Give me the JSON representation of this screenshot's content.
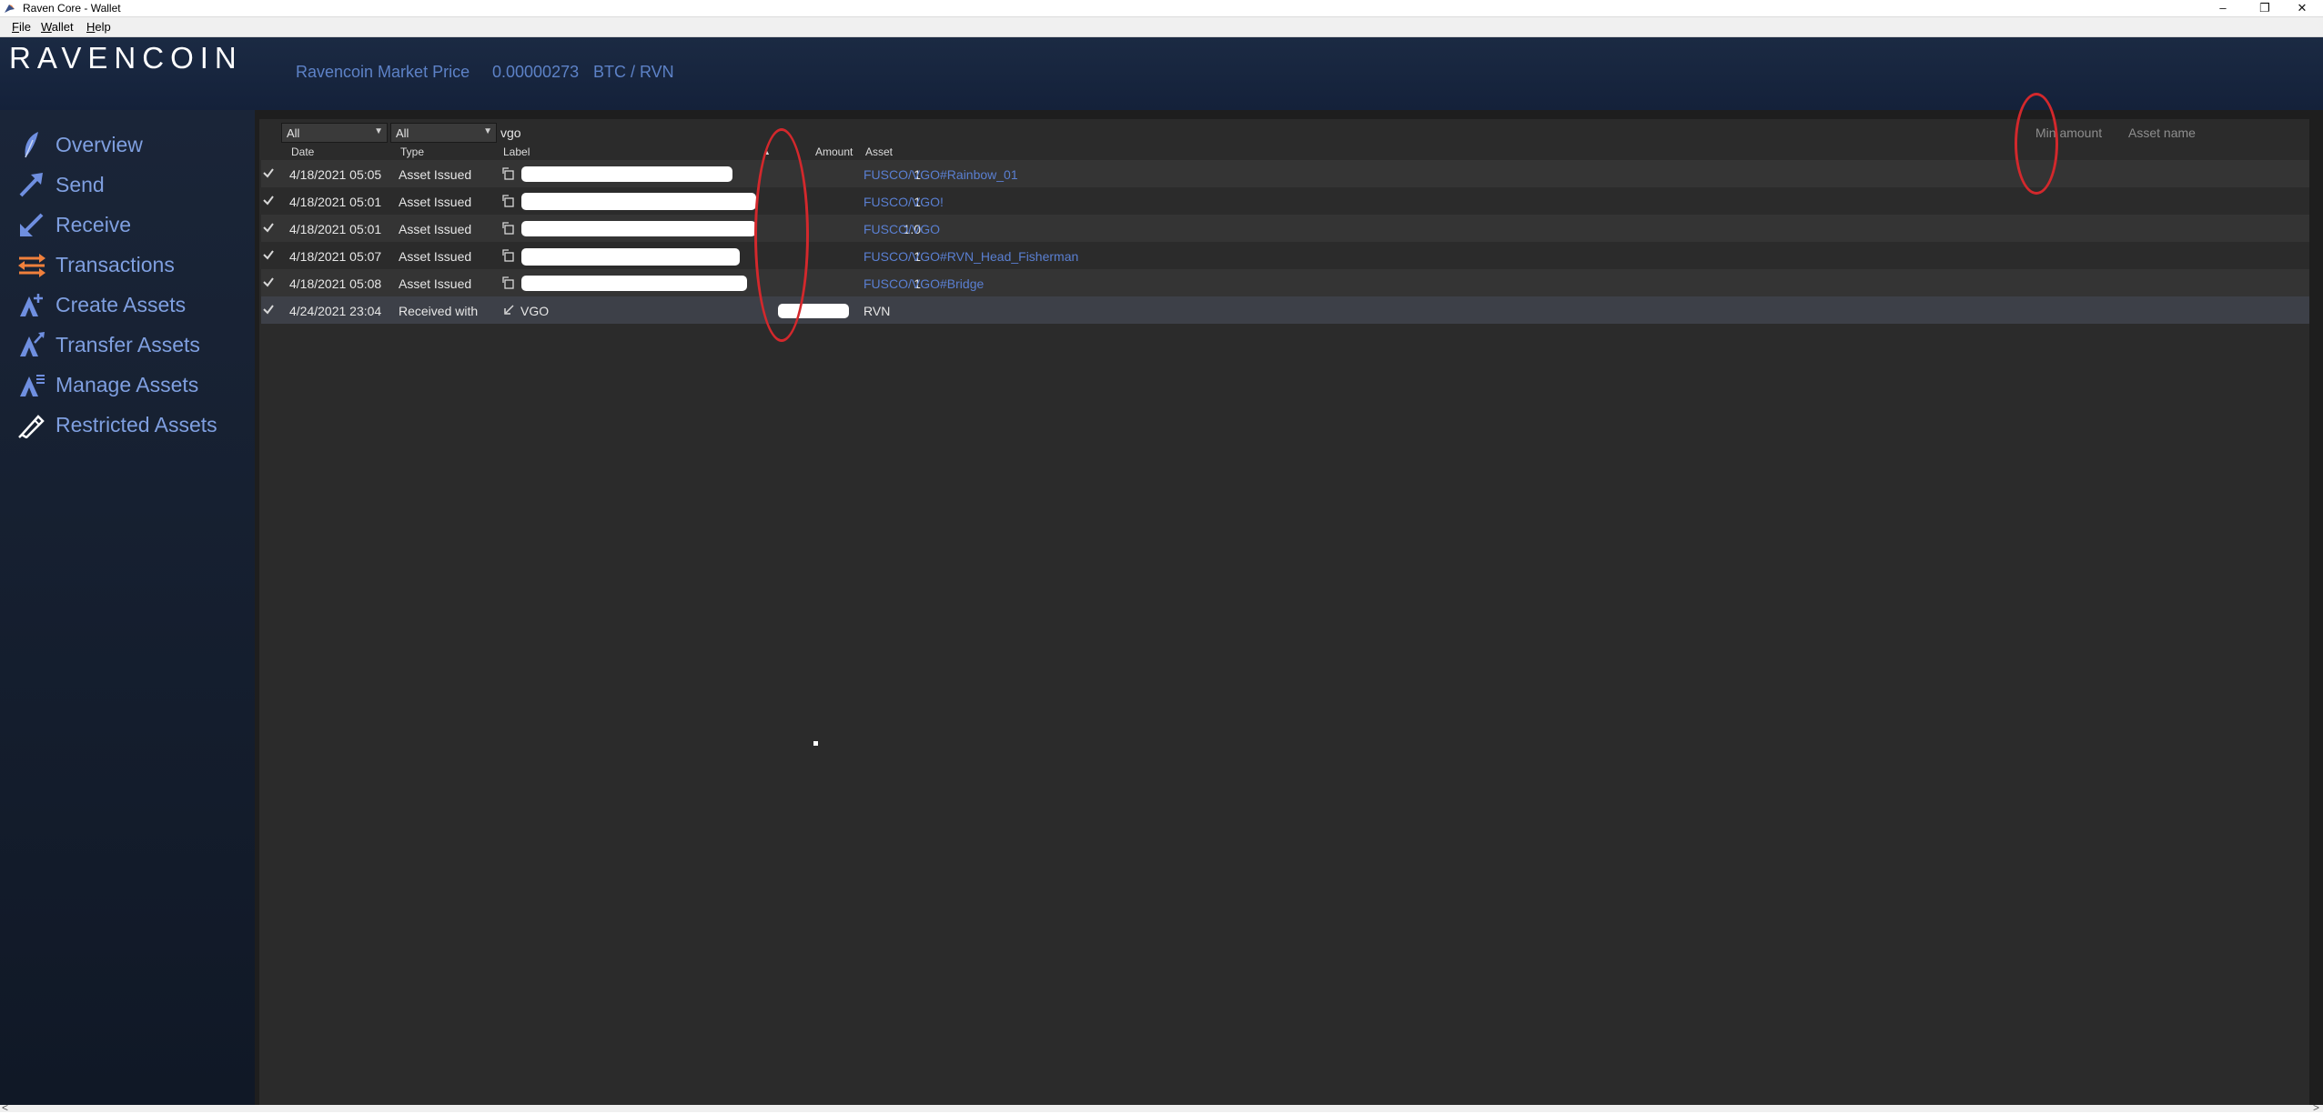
{
  "window": {
    "title": "Raven Core - Wallet",
    "minimize_glyph": "–",
    "restore_glyph": "❐",
    "close_glyph": "✕"
  },
  "menu": {
    "file": {
      "mnemonic": "F",
      "rest": "ile"
    },
    "wallet": {
      "mnemonic": "W",
      "rest": "allet"
    },
    "help": {
      "mnemonic": "H",
      "rest": "elp"
    }
  },
  "header": {
    "logo": "RAVENCOIN",
    "market_label": "Ravencoin Market Price",
    "market_value": "0.00000273",
    "market_unit": "BTC / RVN"
  },
  "sidebar": {
    "items": [
      {
        "label": "Overview",
        "icon": "feather-icon"
      },
      {
        "label": "Send",
        "icon": "send-arrow-icon"
      },
      {
        "label": "Receive",
        "icon": "receive-arrow-icon"
      },
      {
        "label": "Transactions",
        "icon": "transactions-icon"
      },
      {
        "label": "Create Assets",
        "icon": "create-assets-icon"
      },
      {
        "label": "Transfer Assets",
        "icon": "transfer-assets-icon"
      },
      {
        "label": "Manage Assets",
        "icon": "manage-assets-icon"
      },
      {
        "label": "Restricted Assets",
        "icon": "restricted-assets-icon"
      }
    ]
  },
  "filters": {
    "date_filter": "All",
    "type_filter": "All",
    "search_value": "vgo",
    "min_amount_placeholder": "Min amount",
    "asset_name_placeholder": "Asset name"
  },
  "table": {
    "columns": {
      "date": "Date",
      "type": "Type",
      "label": "Label",
      "amount": "Amount",
      "asset": "Asset"
    },
    "sort_indicator": "▲",
    "rows": [
      {
        "date": "4/18/2021 05:05",
        "type": "Asset Issued",
        "label": "",
        "amount": "1",
        "asset": "FUSCO/VGO#Rainbow_01"
      },
      {
        "date": "4/18/2021 05:01",
        "type": "Asset Issued",
        "label": "",
        "amount": "1",
        "asset": "FUSCO/VGO!"
      },
      {
        "date": "4/18/2021 05:01",
        "type": "Asset Issued",
        "label": "",
        "amount": "1.0",
        "asset": "FUSCO/VGO"
      },
      {
        "date": "4/18/2021 05:07",
        "type": "Asset Issued",
        "label": "",
        "amount": "1",
        "asset": "FUSCO/VGO#RVN_Head_Fisherman"
      },
      {
        "date": "4/18/2021 05:08",
        "type": "Asset Issued",
        "label": "",
        "amount": "1",
        "asset": "FUSCO/VGO#Bridge"
      },
      {
        "date": "4/24/2021 23:04",
        "type": "Received with",
        "label": "VGO",
        "amount": "",
        "asset": "RVN"
      }
    ]
  },
  "colors": {
    "accent_blue": "#5a7fd1",
    "header_bg": "#1b2a43",
    "annotation_red": "#d3282c"
  },
  "scrollbar": {
    "left_glyph": "<",
    "right_glyph": ">"
  }
}
